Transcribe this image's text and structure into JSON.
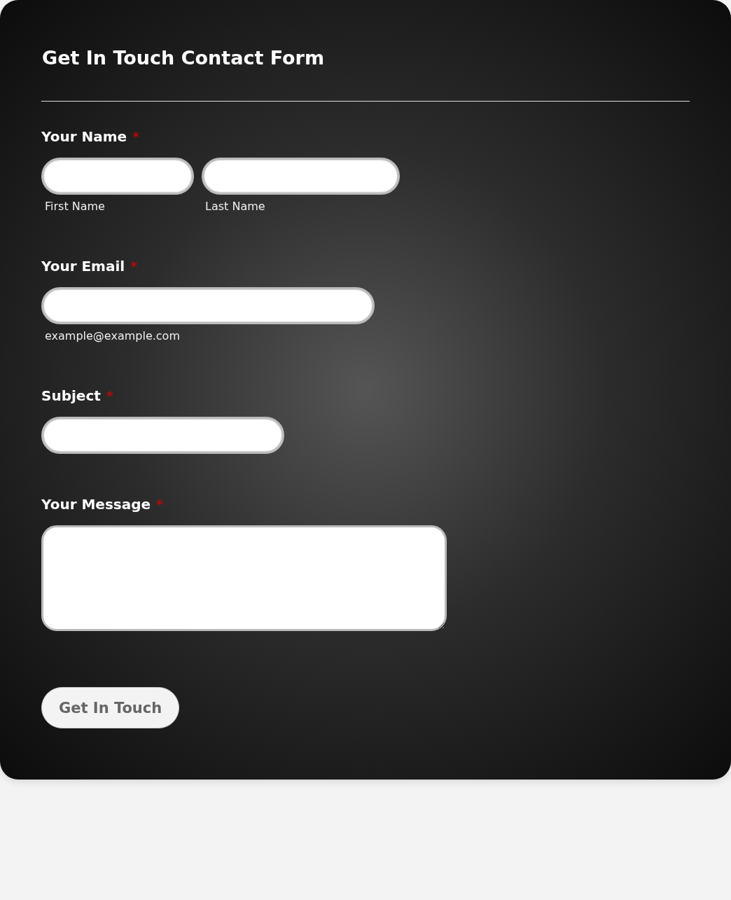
{
  "form": {
    "title": "Get In Touch Contact Form",
    "fields": [
      {
        "kind": "name",
        "label": "Your Name",
        "required": true,
        "marker": "*",
        "inputs": [
          {
            "sublabel": "First Name"
          },
          {
            "sublabel": "Last Name"
          }
        ]
      },
      {
        "kind": "email",
        "label": "Your Email",
        "required": true,
        "marker": "*",
        "inputs": [
          {
            "sublabel": "example@example.com"
          }
        ]
      },
      {
        "kind": "text",
        "label": "Subject",
        "required": true,
        "marker": "*"
      },
      {
        "kind": "textarea",
        "label": "Your Message",
        "required": true,
        "marker": "*"
      }
    ],
    "submit": "Get In Touch"
  }
}
